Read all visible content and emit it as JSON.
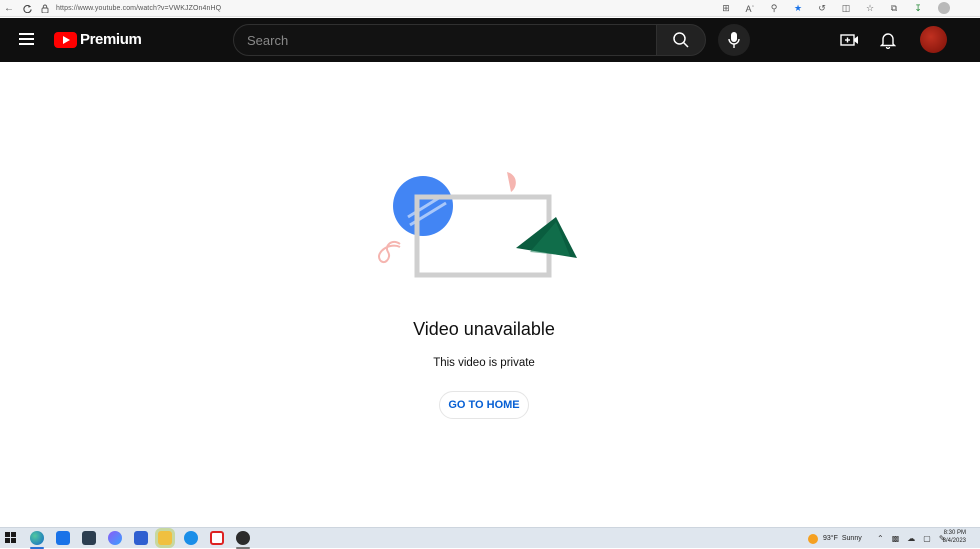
{
  "browser": {
    "url": "https://www.youtube.com/watch?v=VWKJZOn4nHQ"
  },
  "header": {
    "logo_text": "Premium",
    "search_placeholder": "Search"
  },
  "main": {
    "title": "Video unavailable",
    "message": "This video is private",
    "home_button": "GO TO HOME"
  },
  "taskbar": {
    "weather_temp": "93°F",
    "weather_condition": "Sunny",
    "time": "8:30 PM",
    "date": "8/4/2023"
  },
  "colors": {
    "header_bg": "#0f0f0f",
    "brand_red": "#ff0000",
    "link_blue": "#065fd4",
    "illustration_blue": "#4285f4",
    "illustration_green": "#0a5d3f",
    "illustration_pink": "#f5b5b0"
  }
}
